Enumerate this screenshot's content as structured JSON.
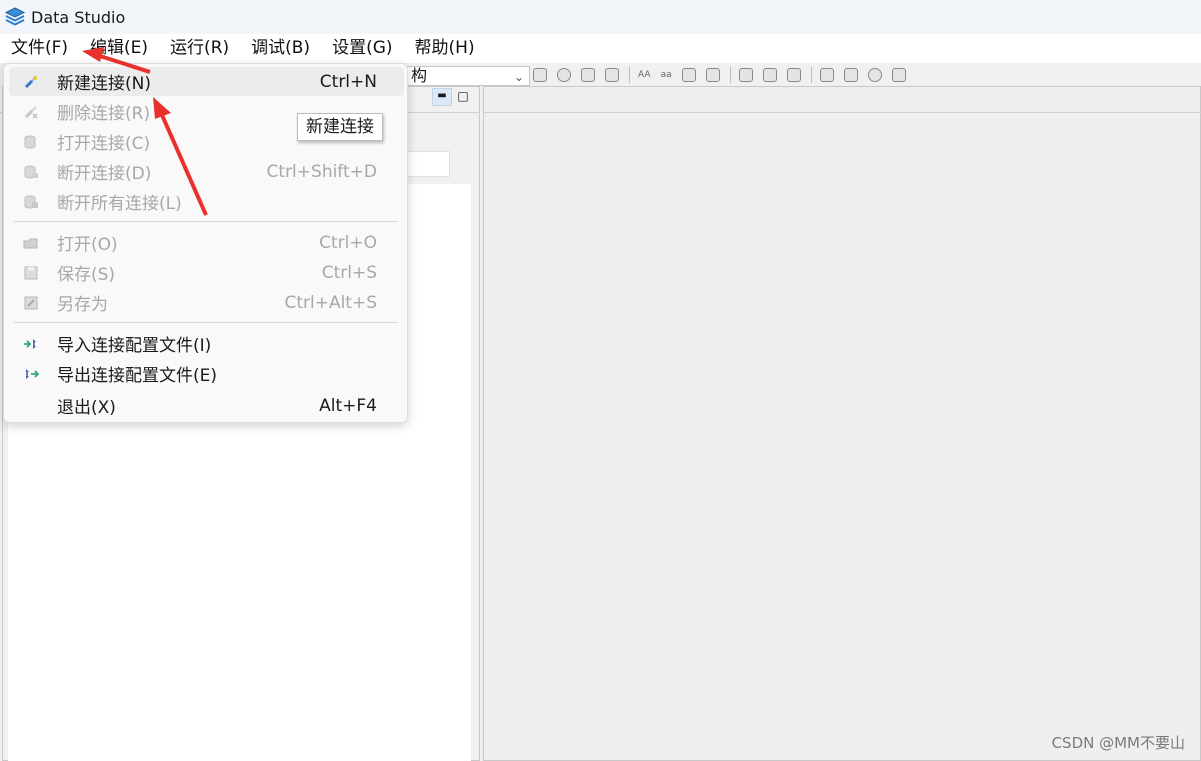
{
  "app": {
    "title": "Data Studio"
  },
  "menubar": {
    "items": [
      {
        "label": "文件(F)"
      },
      {
        "label": "编辑(E)"
      },
      {
        "label": "运行(R)"
      },
      {
        "label": "调试(B)"
      },
      {
        "label": "设置(G)"
      },
      {
        "label": "帮助(H)"
      }
    ]
  },
  "toolbar": {
    "combo_value": "构"
  },
  "file_menu": {
    "items": [
      {
        "label": "新建连接(N)",
        "shortcut": "Ctrl+N",
        "enabled": true,
        "hovered": true,
        "icon": "plug-add-icon"
      },
      {
        "label": "删除连接(R)",
        "shortcut": "",
        "enabled": false,
        "icon": "plug-remove-icon"
      },
      {
        "label": "打开连接(C)",
        "shortcut": "",
        "enabled": false,
        "icon": "db-open-icon"
      },
      {
        "label": "断开连接(D)",
        "shortcut": "Ctrl+Shift+D",
        "enabled": false,
        "icon": "db-disconnect-icon"
      },
      {
        "label": "断开所有连接(L)",
        "shortcut": "",
        "enabled": false,
        "icon": "db-disconnect-all-icon"
      },
      {
        "label": "打开(O)",
        "shortcut": "Ctrl+O",
        "enabled": false,
        "icon": "folder-open-icon"
      },
      {
        "label": "保存(S)",
        "shortcut": "Ctrl+S",
        "enabled": false,
        "icon": "save-icon"
      },
      {
        "label": "另存为",
        "shortcut": "Ctrl+Alt+S",
        "enabled": false,
        "icon": "save-as-icon"
      },
      {
        "label": "导入连接配置文件(I)",
        "shortcut": "",
        "enabled": true,
        "icon": "import-icon"
      },
      {
        "label": "导出连接配置文件(E)",
        "shortcut": "",
        "enabled": true,
        "icon": "export-icon"
      },
      {
        "label": "退出(X)",
        "shortcut": "Alt+F4",
        "enabled": true,
        "icon": ""
      }
    ]
  },
  "tooltip": {
    "text": "新建连接"
  },
  "watermark": {
    "text": "CSDN @MM不要山"
  },
  "colors": {
    "accent": "#2b7bd0",
    "annotation_arrow": "#e8302c",
    "disabled_text": "#a8a8a8"
  }
}
